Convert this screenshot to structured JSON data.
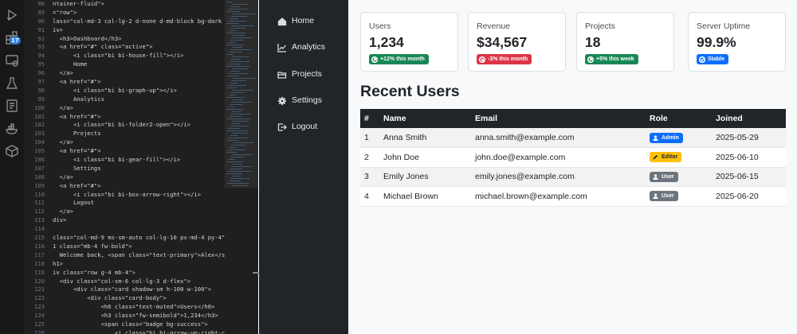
{
  "activity_bar": {
    "icons": [
      "explorer-icon",
      "run-debug-icon",
      "extensions-icon",
      "remote-explorer-icon",
      "testing-icon",
      "notebook-icon",
      "docker-icon",
      "package-icon"
    ],
    "extensions_badge": "17"
  },
  "editor": {
    "lines": [
      {
        "n": "88",
        "code": "ntainer-fluid\">"
      },
      {
        "n": "89",
        "code": "=\"row\">"
      },
      {
        "n": "90",
        "code": "lass=\"col-md-3 col-lg-2 d-none d-md-block bg-dark"
      },
      {
        "n": "91",
        "code": "iv>"
      },
      {
        "n": "92",
        "code": "  <h3>Dashboard</h3>"
      },
      {
        "n": "93",
        "code": "  <a href=\"#\" class=\"active\">"
      },
      {
        "n": "94",
        "code": "      <i class=\"bi bi-house-fill\"></i>"
      },
      {
        "n": "95",
        "code": "      Home"
      },
      {
        "n": "96",
        "code": "  </a>"
      },
      {
        "n": "97",
        "code": "  <a href=\"#\">"
      },
      {
        "n": "98",
        "code": "      <i class=\"bi bi-graph-up\"></i>"
      },
      {
        "n": "99",
        "code": "      Analytics"
      },
      {
        "n": "100",
        "code": "  </a>"
      },
      {
        "n": "101",
        "code": "  <a href=\"#\">"
      },
      {
        "n": "102",
        "code": "      <i class=\"bi bi-folder2-open\"></i>"
      },
      {
        "n": "103",
        "code": "      Projects"
      },
      {
        "n": "104",
        "code": "  </a>"
      },
      {
        "n": "105",
        "code": "  <a href=\"#\">"
      },
      {
        "n": "106",
        "code": "      <i class=\"bi bi-gear-fill\"></i>"
      },
      {
        "n": "107",
        "code": "      Settings"
      },
      {
        "n": "108",
        "code": "  </a>"
      },
      {
        "n": "109",
        "code": "  <a href=\"#\">"
      },
      {
        "n": "110",
        "code": "      <i class=\"bi bi-box-arrow-right\"></i>"
      },
      {
        "n": "111",
        "code": "      Logout"
      },
      {
        "n": "112",
        "code": "  </a>"
      },
      {
        "n": "113",
        "code": "div>"
      },
      {
        "n": "114",
        "code": ""
      },
      {
        "n": "115",
        "code": "class=\"col-md-9 ms-sm-auto col-lg-10 px-md-4 py-4\""
      },
      {
        "n": "116",
        "code": "1 class=\"mb-4 fw-bold\">"
      },
      {
        "n": "117",
        "code": "  Welcome back, <span class=\"text-primary\">Alex</s"
      },
      {
        "n": "118",
        "code": "h1>"
      },
      {
        "n": "119",
        "code": "iv class=\"row g-4 mb-4\">"
      },
      {
        "n": "120",
        "code": "  <div class=\"col-sm-6 col-lg-3 d-flex\">"
      },
      {
        "n": "121",
        "code": "      <div class=\"card shadow-sm h-100 w-100\">"
      },
      {
        "n": "122",
        "code": "          <div class=\"card-body\">"
      },
      {
        "n": "123",
        "code": "              <h6 class=\"text-muted\">Users</h6>"
      },
      {
        "n": "124",
        "code": "              <h3 class=\"fw-semibold\">1,234</h3>"
      },
      {
        "n": "125",
        "code": "              <span class=\"badge bg-success\">"
      },
      {
        "n": "126",
        "code": "                  <i class=\"bi bi-arrow-up-right-c"
      }
    ]
  },
  "sidebar": {
    "items": [
      {
        "label": "Home",
        "icon": "house-icon",
        "active": true
      },
      {
        "label": "Analytics",
        "icon": "graph-up-icon",
        "active": false
      },
      {
        "label": "Projects",
        "icon": "folder-open-icon",
        "active": false
      },
      {
        "label": "Settings",
        "icon": "gear-icon",
        "active": false
      },
      {
        "label": "Logout",
        "icon": "box-arrow-right-icon",
        "active": false
      }
    ]
  },
  "stats": [
    {
      "title": "Users",
      "value": "1,234",
      "badge": "+12% this month",
      "badge_color": "#198754",
      "badge_icon": "arrow-up-right-circle-icon"
    },
    {
      "title": "Revenue",
      "value": "$34,567",
      "badge": "-3% this month",
      "badge_color": "#dc3545",
      "badge_icon": "arrow-down-right-circle-icon"
    },
    {
      "title": "Projects",
      "value": "18",
      "badge": "+5% this week",
      "badge_color": "#198754",
      "badge_icon": "arrow-up-right-circle-icon"
    },
    {
      "title": "Server Uptime",
      "value": "99.9%",
      "badge": "Stable",
      "badge_color": "#0d6efd",
      "badge_icon": "check-circle-icon"
    }
  ],
  "recent_users": {
    "title": "Recent Users",
    "columns": [
      "#",
      "Name",
      "Email",
      "Role",
      "Joined"
    ],
    "rows": [
      {
        "id": "1",
        "name": "Anna Smith",
        "email": "anna.smith@example.com",
        "role": "Admin",
        "role_color": "#0d6efd",
        "role_text_color": "#ffffff",
        "role_icon": "person-icon",
        "joined": "2025-05-29"
      },
      {
        "id": "2",
        "name": "John Doe",
        "email": "john.doe@example.com",
        "role": "Editor",
        "role_color": "#ffc107",
        "role_text_color": "#212529",
        "role_icon": "pencil-icon",
        "joined": "2025-06-10"
      },
      {
        "id": "3",
        "name": "Emily Jones",
        "email": "emily.jones@example.com",
        "role": "User",
        "role_color": "#6c757d",
        "role_text_color": "#ffffff",
        "role_icon": "person-icon",
        "joined": "2025-06-15"
      },
      {
        "id": "4",
        "name": "Michael Brown",
        "email": "michael.brown@example.com",
        "role": "User",
        "role_color": "#6c757d",
        "role_text_color": "#ffffff",
        "role_icon": "person-icon",
        "joined": "2025-06-20"
      }
    ]
  }
}
